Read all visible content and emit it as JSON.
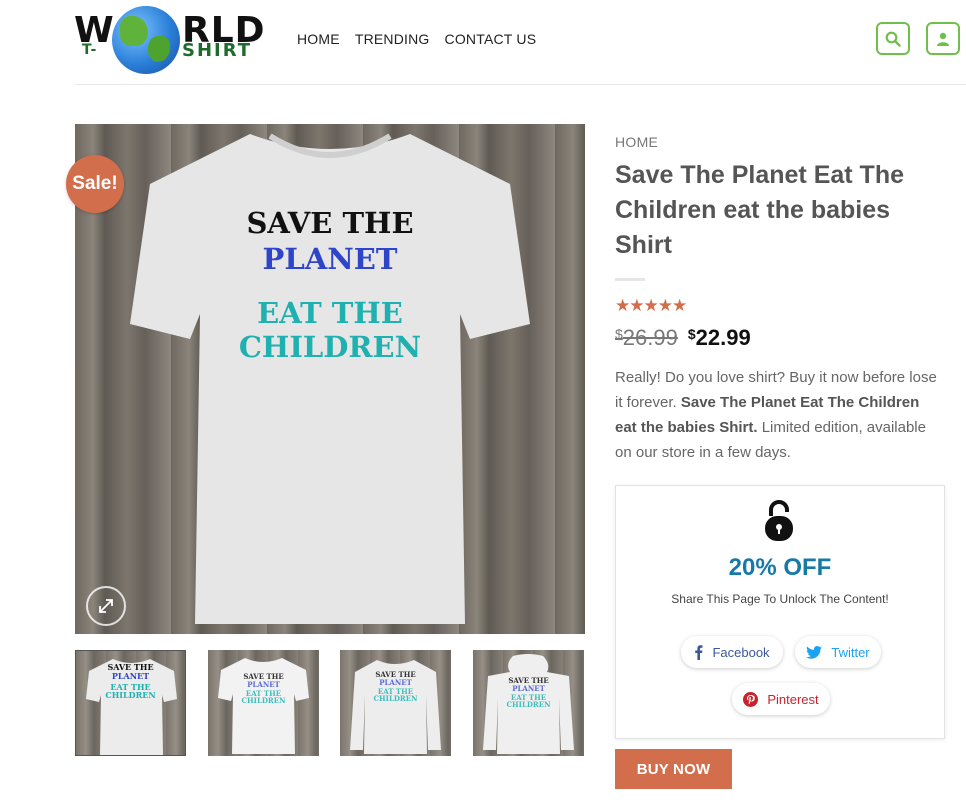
{
  "logo": {
    "word_left": "W",
    "word_right": "RLD",
    "sub_left": "T-",
    "sub_right": "SHIRT"
  },
  "nav": {
    "items": [
      "HOME",
      "TRENDING",
      "CONTACT US"
    ]
  },
  "header_icons": {
    "search": "search-icon",
    "account": "user-icon",
    "accent": "#6fbf4a"
  },
  "gallery": {
    "sale_badge": "Sale!",
    "main_shirt_lines": [
      "SAVE THE",
      "PLANET",
      "EAT THE",
      "CHILDREN"
    ],
    "thumbnails": [
      {
        "lines": [
          "SAVE THE",
          "PLANET",
          "EAT THE",
          "CHILDREN"
        ],
        "active": true
      },
      {
        "lines": [
          "SAVE THE",
          "PLANET",
          "EAT THE",
          "CHILDREN"
        ],
        "active": false
      },
      {
        "lines": [
          "SAVE THE",
          "PLANET",
          "EAT THE",
          "CHILDREN"
        ],
        "active": false
      },
      {
        "lines": [
          "SAVE THE",
          "PLANET",
          "EAT THE",
          "CHILDREN"
        ],
        "active": false
      }
    ]
  },
  "product": {
    "breadcrumb": "HOME",
    "title": "Save The Planet Eat The Children eat the babies Shirt",
    "rating_stars": 5,
    "stars_text": "★★★★★",
    "old_price_currency": "$",
    "old_price": "26.99",
    "new_price_currency": "$",
    "new_price": "22.99",
    "description_start": "Really! Do you love shirt? Buy it now before lose it forever. ",
    "description_bold": "Save The Planet Eat The Children eat the babies Shirt.",
    "description_end": " Limited edition, available on our store in a few days.",
    "accent": "#d26e4b"
  },
  "unlock": {
    "icon": "lock-icon",
    "offer": "20% OFF",
    "subtitle": "Share This Page To Unlock The Content!",
    "share_buttons": [
      {
        "label": "Facebook",
        "icon": "facebook-icon",
        "color": "#3b5998"
      },
      {
        "label": "Twitter",
        "icon": "twitter-icon",
        "color": "#1da1f2"
      },
      {
        "label": "Pinterest",
        "icon": "pinterest-icon",
        "color": "#c8232c"
      }
    ]
  },
  "buy_button": "BUY NOW"
}
